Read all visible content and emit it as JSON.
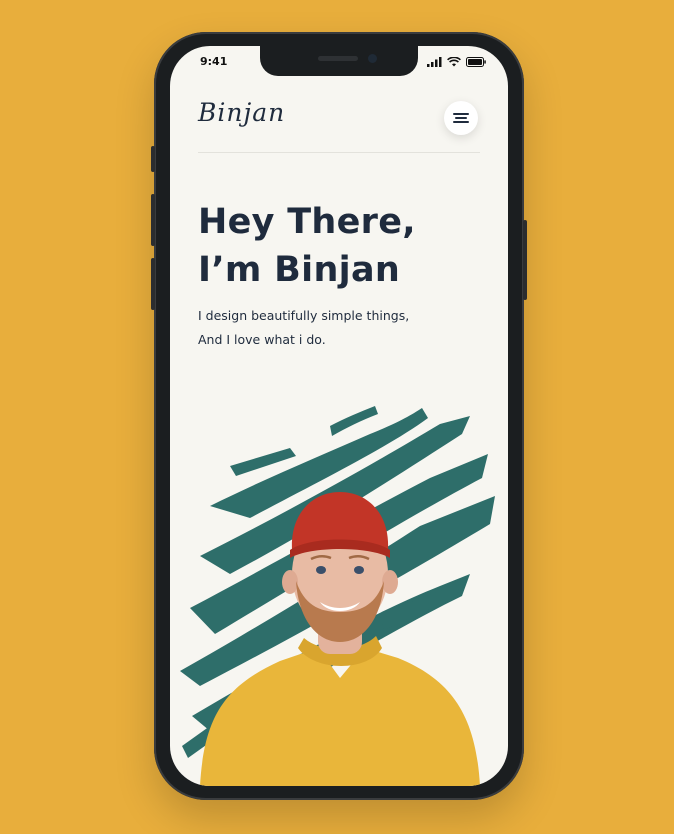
{
  "status_bar": {
    "time": "9:41",
    "icons": [
      "signal-icon",
      "wifi-icon",
      "battery-icon"
    ]
  },
  "header": {
    "logo_text": "Binjan",
    "menu_icon": "hamburger-menu-icon"
  },
  "hero": {
    "title_line1": "Hey There,",
    "title_line2": "I’m Binjan",
    "subtitle_line1": "I design beautifully simple things,",
    "subtitle_line2": "And I love what i do."
  },
  "colors": {
    "background": "#E8AE3C",
    "screen": "#F7F6F1",
    "text_dark": "#1F2B3D",
    "brush_teal": "#2E6E6A",
    "sweater_yellow": "#E9B63A",
    "beanie_red": "#C23527"
  }
}
